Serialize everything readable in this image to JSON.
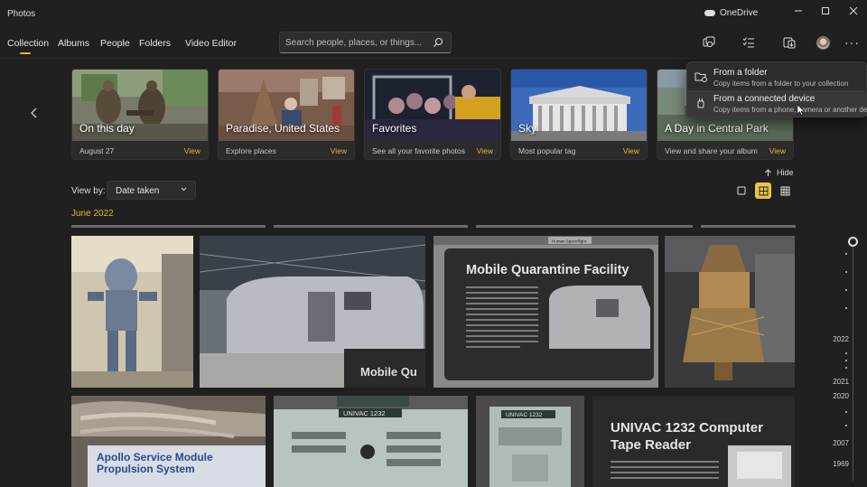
{
  "app": {
    "title": "Photos",
    "onedrive_label": "OneDrive"
  },
  "nav": {
    "items": [
      {
        "label": "Collection",
        "active": true
      },
      {
        "label": "Albums"
      },
      {
        "label": "People"
      },
      {
        "label": "Folders"
      },
      {
        "label": "Video Editor"
      }
    ]
  },
  "search": {
    "placeholder": "Search people, places, or things..."
  },
  "toolbar": {
    "icons": [
      "slideshow-icon",
      "select-icon",
      "import-icon",
      "avatar",
      "more-icon"
    ]
  },
  "cards": [
    {
      "title": "On this day",
      "subtitle": "August 27",
      "view": "View"
    },
    {
      "title": "Paradise, United States",
      "subtitle": "Explore places",
      "view": "View"
    },
    {
      "title": "Favorites",
      "subtitle": "See all your favorite photos",
      "view": "View"
    },
    {
      "title": "Sky",
      "subtitle": "Most popular tag",
      "view": "View"
    },
    {
      "title": "A Day in Central Park",
      "subtitle": "View and share your album",
      "view": "View"
    }
  ],
  "import_menu": {
    "items": [
      {
        "title": "From a folder",
        "description": "Copy items from a folder to your collection"
      },
      {
        "title": "From a connected device",
        "description": "Copy items from a phone, camera or another device"
      }
    ]
  },
  "view_controls": {
    "hide_label": "Hide",
    "view_by_label": "View by:",
    "view_by_value": "Date taken",
    "layouts": [
      "small-grid",
      "medium-grid",
      "large-grid"
    ],
    "active_layout": "medium-grid"
  },
  "month_heading": "June 2022",
  "photos": {
    "row1": [
      {
        "name": "robot-toy"
      },
      {
        "name": "airstream-trailer"
      },
      {
        "name": "mobile-quarantine-facility-sign",
        "sign_title": "Mobile Quarantine Facility",
        "sign_small": "Mobile Qu",
        "sign_plaque": "Human Spaceflight"
      },
      {
        "name": "spacecraft-engine"
      }
    ],
    "row2": [
      {
        "name": "apollo-service-module",
        "sign_title": "Apollo Service Module",
        "sign_title2": "Propulsion System"
      },
      {
        "name": "univac-console",
        "panel_label": "UNIVAC 1232"
      },
      {
        "name": "univac-tape-unit",
        "panel_label": "UNIVAC 1232"
      },
      {
        "name": "univac-tape-reader-sign",
        "sign_title": "UNIVAC 1232 Computer",
        "sign_title2": "Tape Reader"
      }
    ]
  },
  "timeline": {
    "years": [
      "2022",
      "2021",
      "2020",
      "2007",
      "1969"
    ]
  },
  "colors": {
    "accent": "#e8b43a",
    "background": "#202020",
    "card": "#2b2b2b"
  }
}
